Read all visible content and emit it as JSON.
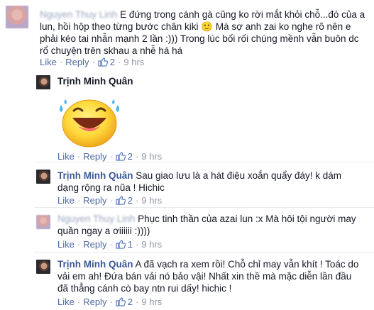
{
  "comments": [
    {
      "author": "Nguyen Thuy Linh",
      "text": "E đứng trong cánh gà cũng ko rời mắt khỏi chỗ...đó của a lun, hồi hộp theo từng bước chân kiki 🙂 Mà sợ anh zai ko nghe rõ nên e phải kéo tai nhẫn mạnh 2 lần :))) Trong lúc bối rối chúng mềnh vẫn buôn dc rổ chuyện trên skhau a nhễ há há",
      "like_label": "Like",
      "reply_label": "Reply",
      "like_count": "2",
      "time": "9 hrs"
    },
    {
      "author": "Trịnh Minh Quân",
      "sticker": "laughing-face-sticker",
      "like_label": "Like",
      "reply_label": "Reply",
      "like_count": "2",
      "time": "9 hrs"
    },
    {
      "author": "Trịnh Minh Quân",
      "text": "Sau giao lưu là a hát điệu xoắn quẩy đáy! k dám dạng rộng ra nũa ! Hichic",
      "like_label": "Like",
      "reply_label": "Reply",
      "like_count": "2",
      "time": "9 hrs"
    },
    {
      "author": "Nguyen Thuy Linh",
      "text": "Phục tinh thần của azai lun :x Mà hôi tội người may quần ngay a ơiiiiii :))))",
      "like_label": "Like",
      "reply_label": "Reply",
      "like_count": "1",
      "time": "9 hrs"
    },
    {
      "author": "Trịnh Minh Quân",
      "text": "A đã vạch ra xem rồi! Chỗ chỉ may vẫn khít ! Toác do vải em ah! Đứa bán vải nó bảo vậi! Nhất xin thề mà mặc diễn lần đầu đã thẳng cánh cò bay ntn rui dấy! hichic !",
      "like_label": "Like",
      "reply_label": "Reply",
      "like_count": "2",
      "time": "9 hrs"
    }
  ],
  "colors": {
    "link": "#3b5998",
    "meta": "#9197a3",
    "action": "#4e69a2",
    "text": "#141823"
  }
}
